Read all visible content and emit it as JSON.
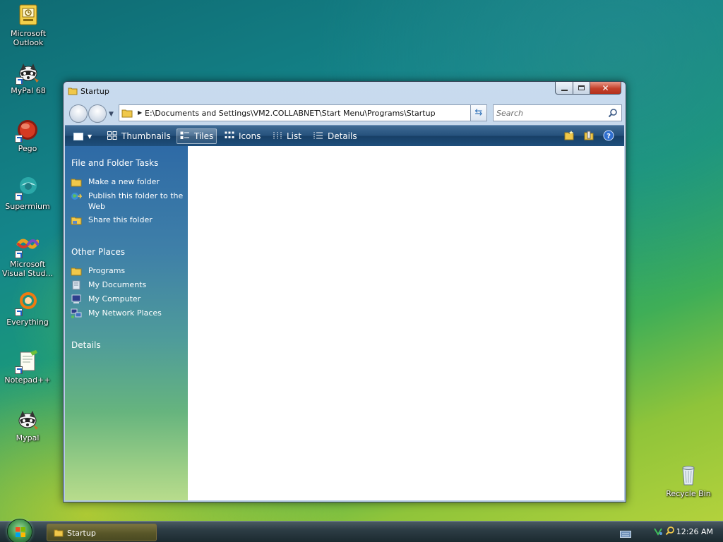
{
  "desktop": {
    "icons": [
      {
        "label": "Microsoft Outlook",
        "icon": "outlook-icon"
      },
      {
        "label": "MyPal 68",
        "icon": "raccoon-icon"
      },
      {
        "label": "Pego",
        "icon": "red-orb-icon"
      },
      {
        "label": "Supermium",
        "icon": "supermium-icon"
      },
      {
        "label": "Microsoft Visual Stud...",
        "icon": "visual-studio-icon"
      },
      {
        "label": "Everything",
        "icon": "everything-icon"
      },
      {
        "label": "Notepad++",
        "icon": "notepad-plus-plus-icon"
      },
      {
        "label": "Mypal",
        "icon": "raccoon-icon"
      },
      {
        "label": "Recycle Bin",
        "icon": "recycle-bin-icon"
      }
    ]
  },
  "window": {
    "title": "Startup",
    "address": "E:\\Documents and Settings\\VM2.COLLABNET\\Start Menu\\Programs\\Startup",
    "search_placeholder": "Search",
    "toolbar": {
      "thumbnails": "Thumbnails",
      "tiles": "Tiles",
      "icons": "Icons",
      "list": "List",
      "details": "Details",
      "active_view": "Tiles"
    },
    "task_pane": {
      "file_folder_tasks": {
        "heading": "File and Folder Tasks",
        "links": [
          "Make a new folder",
          "Publish this folder to the Web",
          "Share this folder"
        ]
      },
      "other_places": {
        "heading": "Other Places",
        "links": [
          "Programs",
          "My Documents",
          "My Computer",
          "My Network Places"
        ]
      },
      "details": {
        "heading": "Details"
      }
    }
  },
  "taskbar": {
    "task_button": "Startup",
    "clock": "12:26 AM"
  },
  "colors": {
    "toolbar": "#24507c",
    "task_pane_top": "#2e6aa6",
    "task_pane_bottom": "#b8dc8c",
    "close_button": "#c4412b"
  }
}
